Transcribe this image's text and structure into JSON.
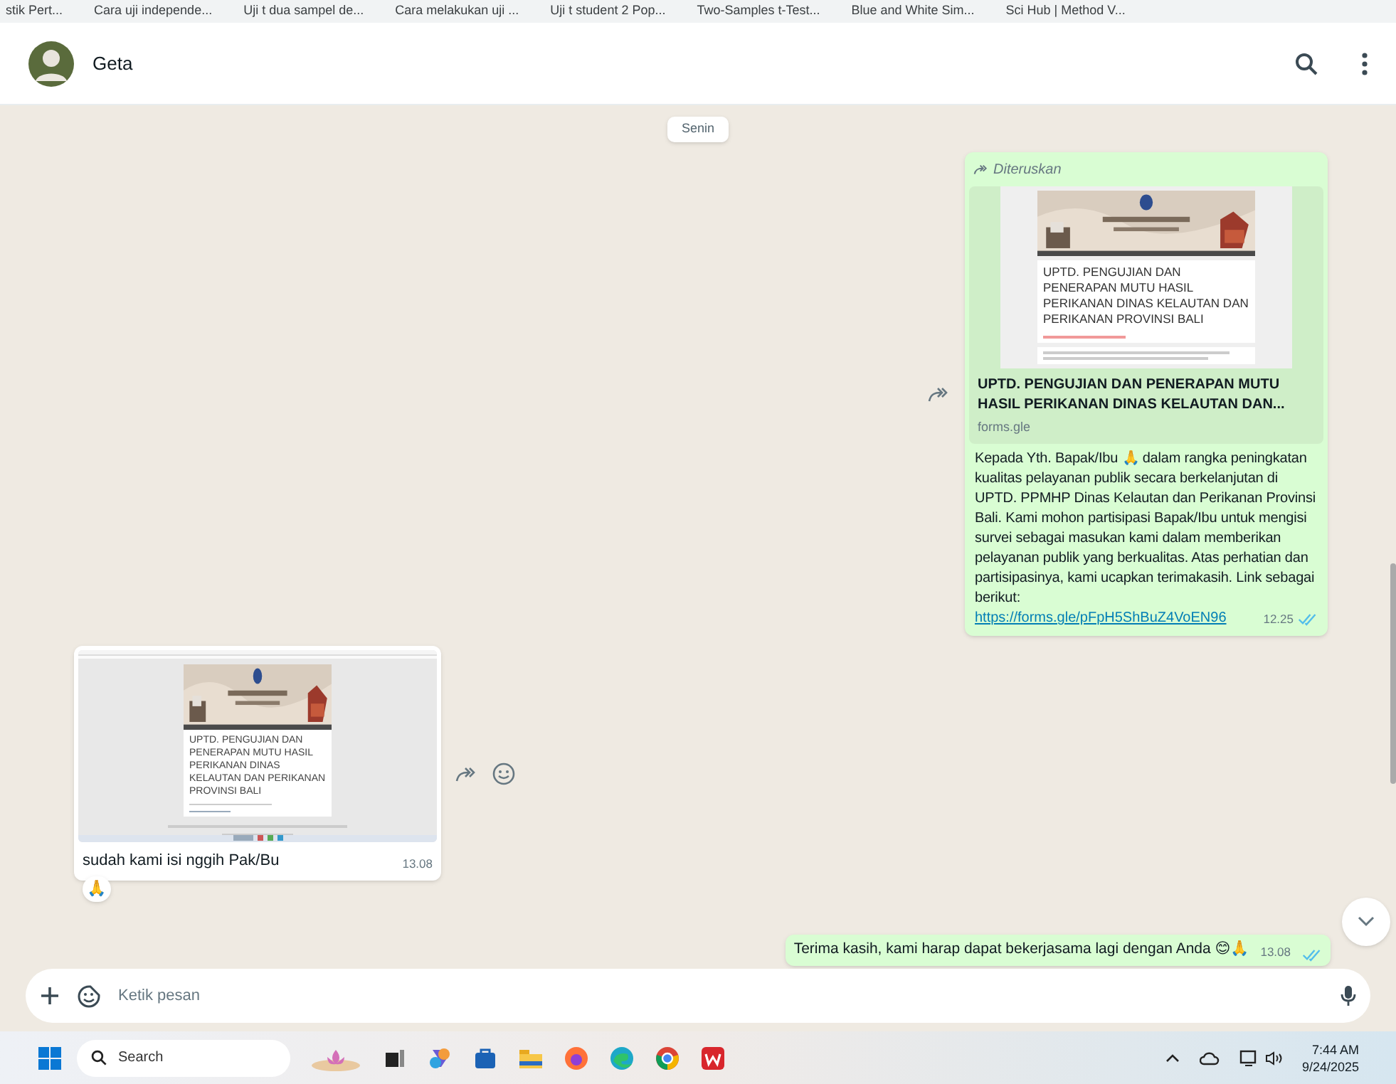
{
  "bookmarks": [
    {
      "label": "stik Pert..."
    },
    {
      "label": "Cara uji independe..."
    },
    {
      "label": "Uji t dua sampel de..."
    },
    {
      "label": "Cara melakukan uji ..."
    },
    {
      "label": "Uji t student 2 Pop..."
    },
    {
      "label": "Two-Samples t-Test..."
    },
    {
      "label": "Blue and White Sim..."
    },
    {
      "label": "Sci Hub | Method V..."
    }
  ],
  "chat_header": {
    "contact_name": "Geta"
  },
  "date_divider": "Senin",
  "messages": [
    {
      "kind": "link",
      "outgoing": true,
      "forwarded_label": "Diteruskan",
      "preview": {
        "thumbnail_title": "UPTD. PENGUJIAN DAN PENERAPAN MUTU HASIL PERIKANAN DINAS KELAUTAN DAN PERIKANAN PROVINSI BALI",
        "title": "UPTD. PENGUJIAN DAN PENERAPAN MUTU HASIL PERIKANAN DINAS KELAUTAN DAN...",
        "domain": "forms.gle"
      },
      "text": "Kepada Yth. Bapak/Ibu 🙏 dalam rangka peningkatan kualitas pelayanan publik secara berkelanjutan di UPTD. PPMHP Dinas Kelautan dan Perikanan Provinsi Bali. Kami mohon partisipasi Bapak/Ibu untuk mengisi survei sebagai masukan kami dalam memberikan pelayanan publik yang berkualitas. Atas perhatian dan partisipasinya, kami ucapkan terimakasih. Link sebagai berikut:",
      "link": "https://forms.gle/pFpH5ShBuZ4VoEN96",
      "time": "12.25",
      "read": true
    },
    {
      "outgoing": false,
      "screenshot_title": "UPTD. PENGUJIAN DAN PENERAPAN MUTU HASIL PERIKANAN DINAS KELAUTAN DAN PERIKANAN PROVINSI BALI",
      "caption": "sudah kami isi nggih Pak/Bu",
      "time": "13.08",
      "reaction": "🙏"
    },
    {
      "kind": "text",
      "outgoing": true,
      "text": "Terima kasih, kami harap dapat bekerjasama lagi dengan Anda 😊🙏",
      "time": "13.08",
      "read": true
    }
  ],
  "composer": {
    "placeholder": "Ketik pesan"
  },
  "taskbar": {
    "search_placeholder": "Search",
    "time": "7:44 AM",
    "date": "9/24/2025"
  }
}
